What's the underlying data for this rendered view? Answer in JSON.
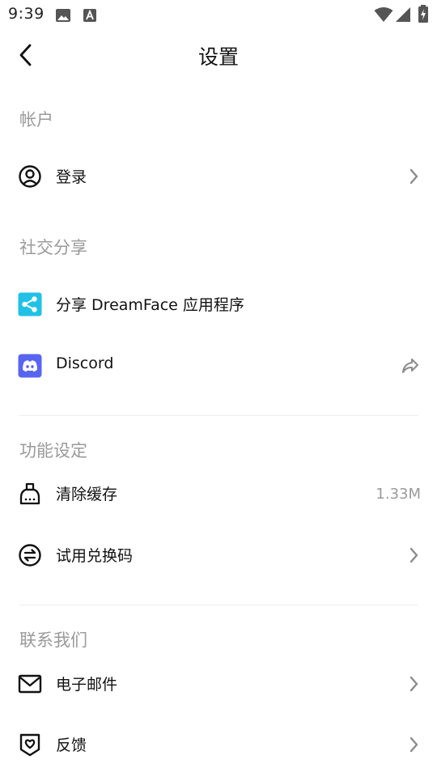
{
  "status_bar": {
    "time": "9:39",
    "icons": [
      "image-icon",
      "a-notification-icon",
      "wifi-icon",
      "signal-icon",
      "battery-charging-icon"
    ]
  },
  "header": {
    "title": "设置",
    "back_icon": "chevron-left-icon"
  },
  "sections": {
    "account": {
      "label": "帐户",
      "items": [
        {
          "label": "登录",
          "icon": "user-circle-icon",
          "trailing": "chevron-right-icon"
        }
      ]
    },
    "social": {
      "label": "社交分享",
      "items": [
        {
          "label": "分享 DreamFace 应用程序",
          "icon": "share-icon",
          "icon_color": "#1fc2e6"
        },
        {
          "label": "Discord",
          "icon": "discord-icon",
          "icon_color": "#5865f2",
          "trailing": "forward-arrow-icon"
        }
      ]
    },
    "features": {
      "label": "功能设定",
      "items": [
        {
          "label": "清除缓存",
          "icon": "broom-icon",
          "value": "1.33M"
        },
        {
          "label": "试用兑换码",
          "icon": "exchange-circle-icon",
          "trailing": "chevron-right-icon"
        }
      ]
    },
    "contact": {
      "label": "联系我们",
      "items": [
        {
          "label": "电子邮件",
          "icon": "mail-icon",
          "trailing": "chevron-right-icon"
        },
        {
          "label": "反馈",
          "icon": "feedback-heart-icon",
          "trailing": "chevron-right-icon"
        }
      ]
    }
  },
  "colors": {
    "text": "#111111",
    "section_label": "#9a9a9a",
    "chevron": "#8c8c8c",
    "divider": "#ededed"
  }
}
